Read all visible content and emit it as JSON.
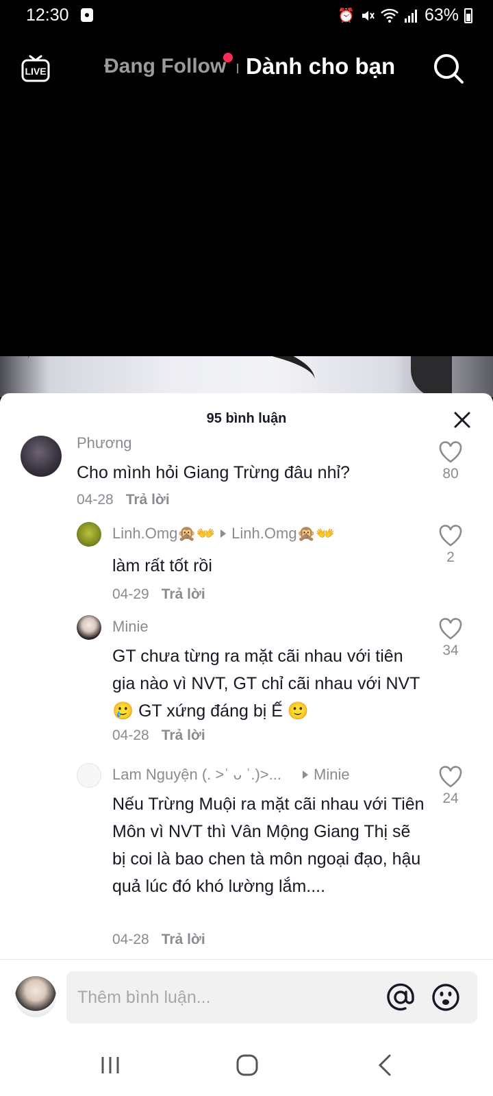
{
  "status_bar": {
    "time": "12:30",
    "battery": "63%"
  },
  "top_nav": {
    "live_label": "LIVE",
    "tab_following": "Đang Follow",
    "tab_foryou": "Dành cho bạn"
  },
  "comments_sheet": {
    "count_label": "95 bình luận",
    "comments": [
      {
        "user": "Phương",
        "text": "Cho mình hỏi Giang Trừng đâu nhỉ?",
        "date": "04-28",
        "reply_label": "Trả lời",
        "likes": "80"
      },
      {
        "user": "Linh.Omg🙊👐",
        "reply_to": "Linh.Omg🙊👐",
        "text": "làm rất tốt rồi",
        "date": "04-29",
        "reply_label": "Trả lời",
        "likes": "2"
      },
      {
        "user": "Minie",
        "text": "GT chưa từng ra mặt cãi nhau với tiên gia nào vì NVT, GT chỉ cãi nhau với NVT 🥲 GT xứng đáng bị Ế 🙂",
        "date": "04-28",
        "reply_label": "Trả lời",
        "likes": "34"
      },
      {
        "user": "Lam Nguyện (. >ʿ ᴗ ʿ.)>...",
        "reply_to": "Minie",
        "text": "Nếu Trừng Muội ra mặt cãi nhau với Tiên Môn vì NVT thì Vân Mộng Giang Thị sẽ bị coi là bao chen tà môn ngoại đạo, hậu quả lúc đó khó lường lắm....",
        "date": "04-28",
        "reply_label": "Trả lời",
        "likes": "24"
      }
    ]
  },
  "input_bar": {
    "placeholder": "Thêm bình luận..."
  },
  "colors": {
    "accent": "#fe2c55",
    "text": "#161823",
    "muted": "#8a8b91"
  }
}
